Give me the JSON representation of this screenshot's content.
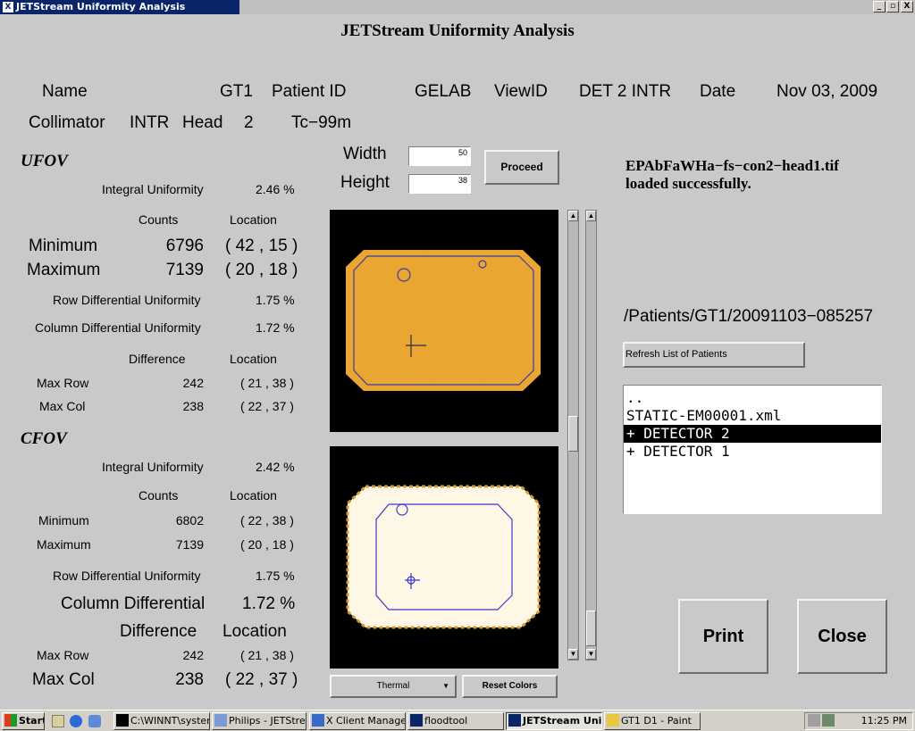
{
  "window": {
    "title": "JETStream Uniformity Analysis",
    "app_icon": "X",
    "min_btn": "_",
    "max_btn": "▫",
    "close_btn": "X"
  },
  "app_title": "JETStream Uniformity Analysis",
  "info": {
    "name_label": "Name",
    "name_value": "GT1",
    "patient_id_label": "Patient ID",
    "patient_id_value": "GELAB",
    "view_id_label": "ViewID",
    "view_id_value": "DET 2 INTR",
    "date_label": "Date",
    "date_value": "Nov 03, 2009",
    "collimator_label": "Collimator",
    "collimator_value": "INTR",
    "head_label": "Head",
    "head_value": "2",
    "isotope": "Tc−99m"
  },
  "controls": {
    "width_label": "Width",
    "width_value": "50",
    "height_label": "Height",
    "height_value": "38",
    "proceed": "Proceed",
    "colormap": "Thermal",
    "reset_colors": "Reset Colors"
  },
  "ufov": {
    "title": "UFOV",
    "integral_label": "Integral Uniformity",
    "integral_value": "2.46 %",
    "counts_header": "Counts",
    "location_header": "Location",
    "min_label": "Minimum",
    "min_counts": "6796",
    "min_location": "( 42 , 15 )",
    "max_label": "Maximum",
    "max_counts": "7139",
    "max_location": "( 20 , 18 )",
    "row_diff_label": "Row Differential Uniformity",
    "row_diff_value": "1.75 %",
    "col_diff_label": "Column Differential Uniformity",
    "col_diff_value": "1.72 %",
    "difference_header": "Difference",
    "location_header2": "Location",
    "max_row_label": "Max Row",
    "max_row_value": "242",
    "max_row_location": "( 21 , 38 )",
    "max_col_label": "Max Col",
    "max_col_value": "238",
    "max_col_location": "( 22 , 37 )"
  },
  "cfov": {
    "title": "CFOV",
    "integral_label": "Integral Uniformity",
    "integral_value": "2.42 %",
    "counts_header": "Counts",
    "location_header": "Location",
    "min_label": "Minimum",
    "min_counts": "6802",
    "min_location": "( 22 , 38 )",
    "max_label": "Maximum",
    "max_counts": "7139",
    "max_location": "( 20 , 18 )",
    "row_diff_label": "Row Differential Uniformity",
    "row_diff_value": "1.75 %",
    "col_diff_label": "Column Differential",
    "col_diff_value": "1.72 %",
    "difference_header": "Difference",
    "location_header2": "Location",
    "max_row_label": "Max Row",
    "max_row_value": "242",
    "max_row_location": "( 21 , 38 )",
    "max_col_label": "Max Col",
    "max_col_value": "238",
    "max_col_location": "( 22 , 37 )"
  },
  "right_panel": {
    "loaded_message": "EPAbFaWHa−fs−con2−head1.tif\nloaded successfully.",
    "patient_path": "/Patients/GT1/20091103−085257",
    "refresh_button": "Refresh List of Patients",
    "files": [
      {
        "label": "..",
        "selected": false
      },
      {
        "label": "STATIC-EM00001.xml",
        "selected": false
      },
      {
        "label": "+ DETECTOR 2",
        "selected": true
      },
      {
        "label": "+ DETECTOR 1",
        "selected": false
      }
    ],
    "print_button": "Print",
    "close_button": "Close"
  },
  "taskbar": {
    "start": "Start",
    "tasks": [
      "C:\\WINNT\\system...",
      "Philips - JETStrea...",
      "X Client Manager",
      "floodtool",
      "JETStream Uni...",
      "GT1 D1 - Paint"
    ],
    "active_task_index": 4,
    "clock": "11:25 PM"
  },
  "colors": {
    "title_active": "#0a246a",
    "ufov_fill": "#e9a32a",
    "ufov_border": "#d07a12",
    "cfov_fill": "#fff7e6",
    "roi_line": "#3030c0"
  },
  "icons": {
    "scroll_up": "▲",
    "scroll_down": "▼",
    "dropdown": "▼"
  }
}
